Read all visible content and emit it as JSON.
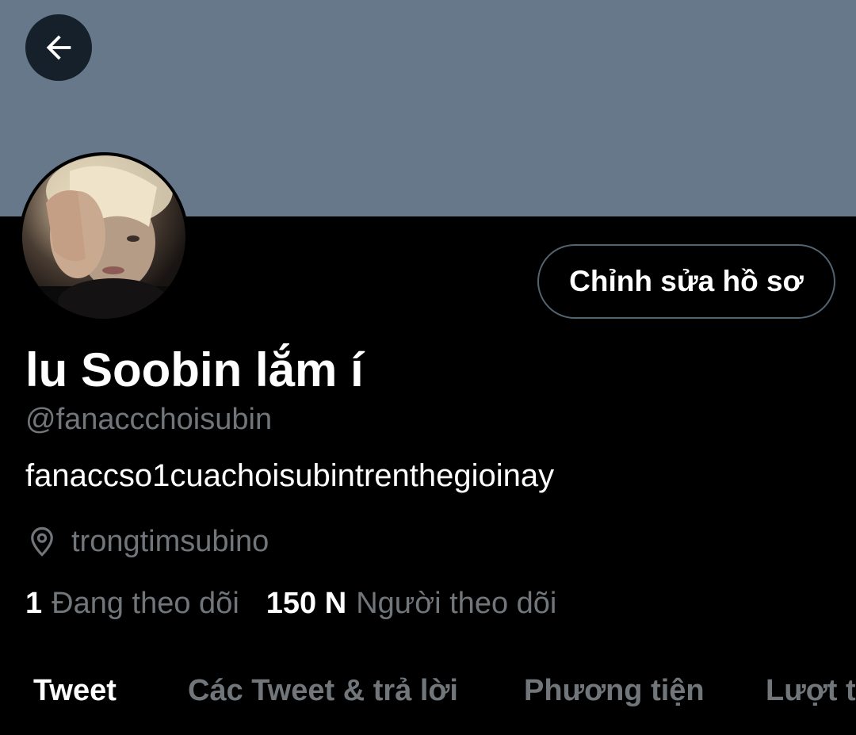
{
  "header": {
    "back_icon": "arrow-left-icon",
    "banner_color": "#66788a"
  },
  "profile": {
    "edit_button_label": "Chỉnh sửa hồ sơ",
    "display_name": "lu Soobin lắm í",
    "handle": "@fanaccchoisubin",
    "bio": "fanaccso1cuachoisubintrenthegioinay",
    "location_icon": "location-pin-icon",
    "location": "trongtimsubino",
    "following_count": "1",
    "following_label": "Đang theo dõi",
    "followers_count": "150 N",
    "followers_label": "Người theo dõi"
  },
  "tabs": [
    {
      "label": "Tweet",
      "active": true
    },
    {
      "label": "Các Tweet & trả lời",
      "active": false
    },
    {
      "label": "Phương tiện",
      "active": false
    },
    {
      "label": "Lượt thích",
      "active": false
    }
  ],
  "colors": {
    "background": "#000000",
    "secondary_text": "#71767b",
    "primary_text": "#ffffff",
    "border": "#536471"
  }
}
